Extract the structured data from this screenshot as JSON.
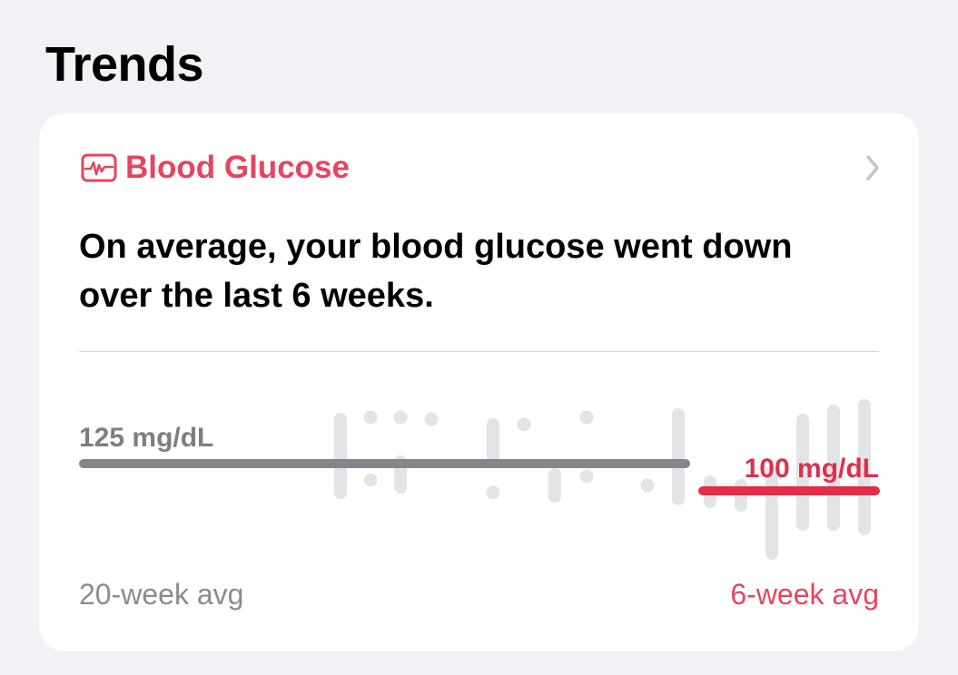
{
  "section": {
    "title": "Trends"
  },
  "card": {
    "metric": "Blood Glucose",
    "metric_icon": "waveform-monitor-icon",
    "accent_color": "#e5455e",
    "summary": "On average, your blood glucose went down over the last 6 weeks.",
    "long_term": {
      "value": "125 mg/dL",
      "caption": "20-week avg"
    },
    "short_term": {
      "value": "100 mg/dL",
      "caption": "6-week avg"
    }
  }
}
